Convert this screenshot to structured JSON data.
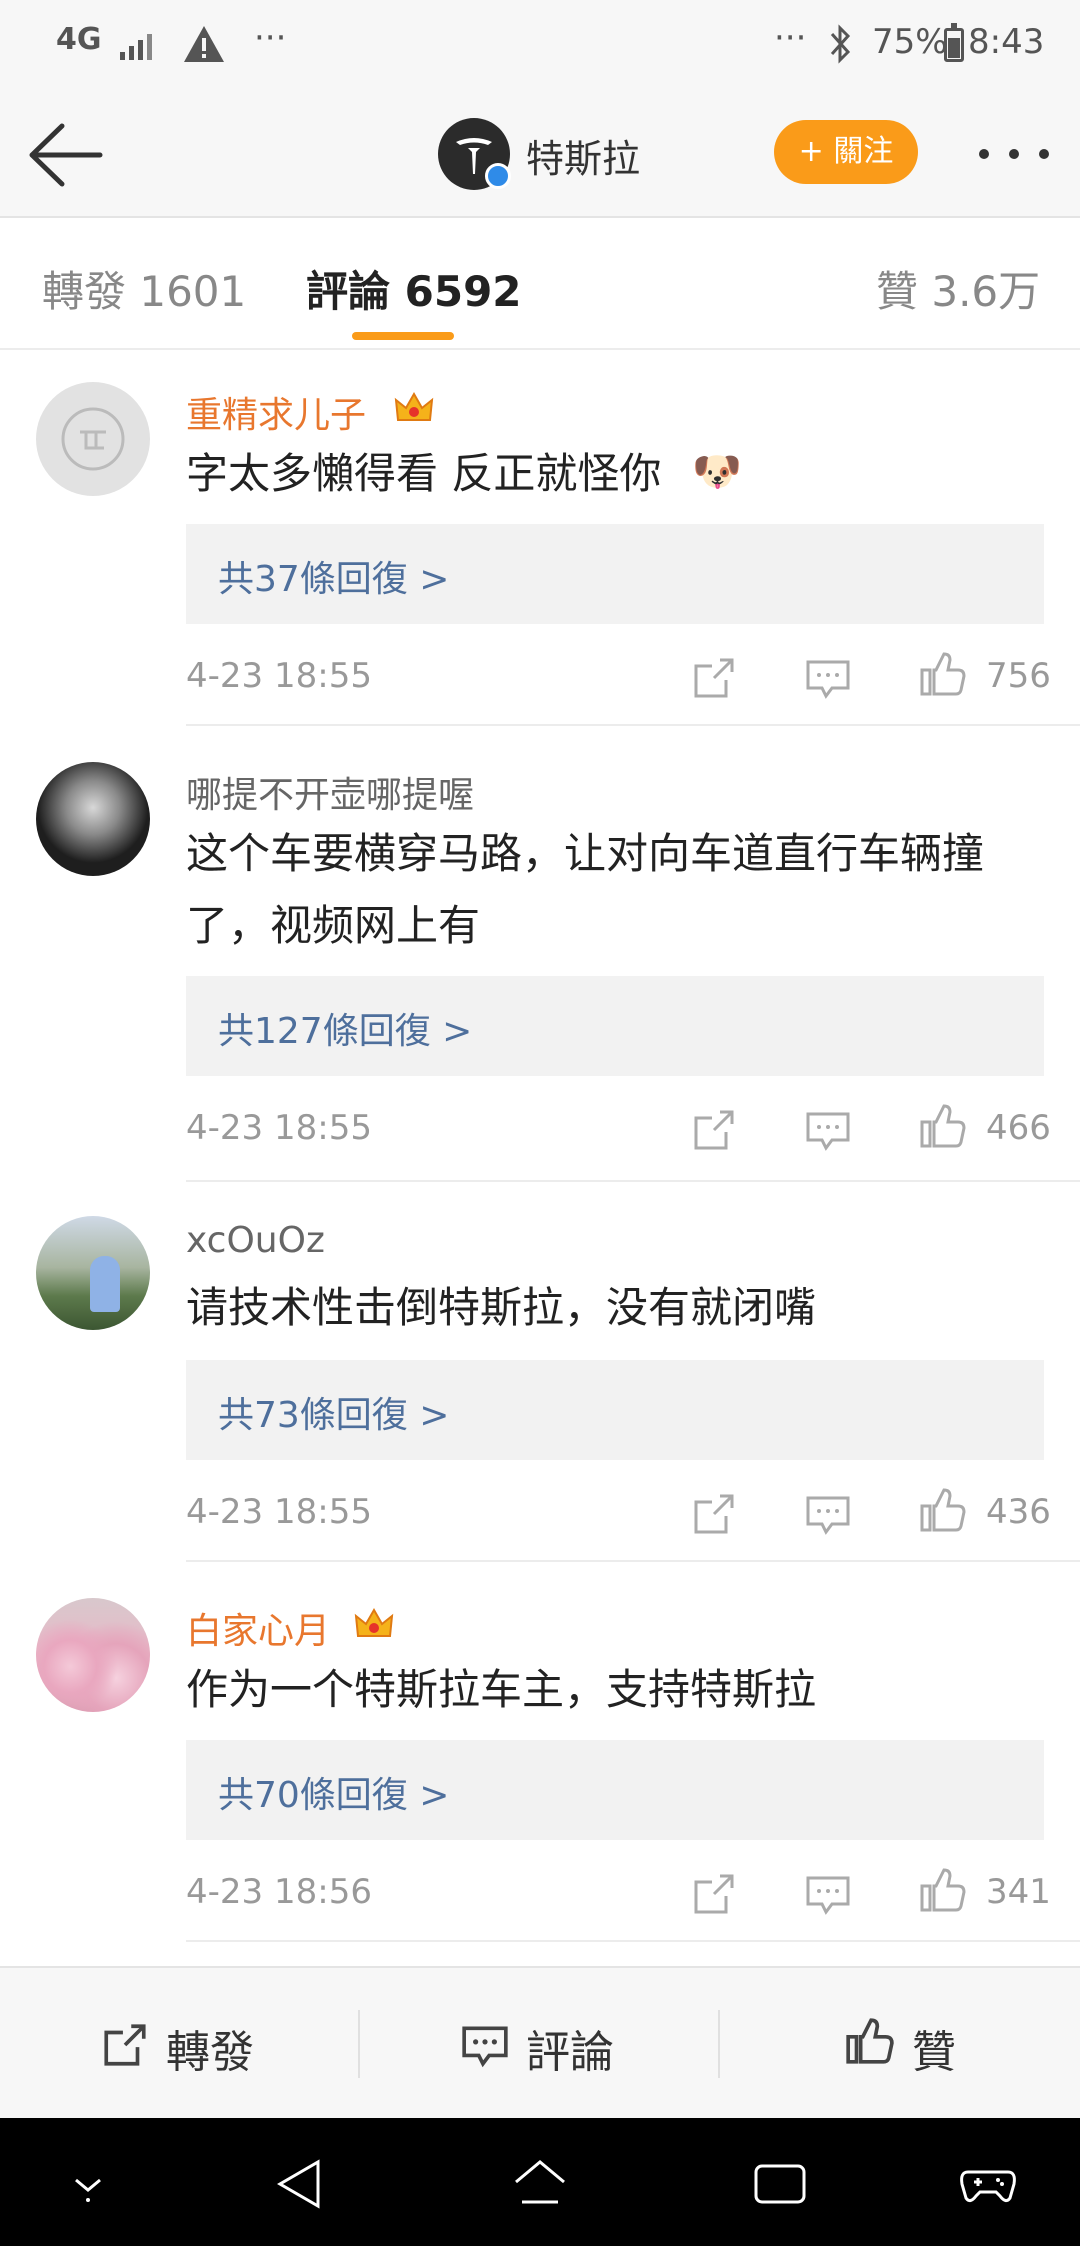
{
  "status_bar": {
    "network": "4G",
    "more": "···",
    "more_right": "···",
    "battery": "75%",
    "time": "8:43"
  },
  "header": {
    "title": "特斯拉",
    "follow_label": "+ 關注"
  },
  "tabs": [
    {
      "label": "轉發 1601"
    },
    {
      "label": "評論 6592"
    },
    {
      "label": "贊 3.6万"
    }
  ],
  "comments": [
    {
      "username": "重精求儿子",
      "vip": true,
      "text": "字太多懶得看 反正就怪你",
      "replies": "共37條回復 >",
      "time": "4-23 18:55",
      "likes": "756"
    },
    {
      "username": "哪提不开壶哪提喔",
      "vip": false,
      "text": "这个车要横穿马路，让对向车道直行车辆撞了，视频网上有",
      "replies": "共127條回復 >",
      "time": "4-23 18:55",
      "likes": "466"
    },
    {
      "username": "xcOuOz",
      "vip": false,
      "text": "请技术性击倒特斯拉，没有就闭嘴",
      "replies": "共73條回復 >",
      "time": "4-23 18:55",
      "likes": "436"
    },
    {
      "username": "白家心月",
      "vip": true,
      "text": "作为一个特斯拉车主，支持特斯拉",
      "replies": "共70條回復 >",
      "time": "4-23 18:56",
      "likes": "341"
    }
  ],
  "bottom_bar": {
    "repost_label": "轉發",
    "comment_label": "評論",
    "like_label": "贊"
  },
  "colors": {
    "accent": "#fa9b19",
    "vip_name": "#e8772e",
    "link": "#4e6f9c"
  }
}
